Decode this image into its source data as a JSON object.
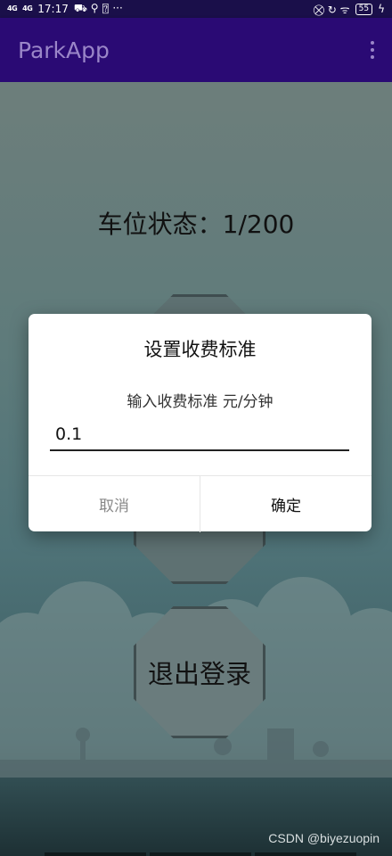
{
  "status_bar": {
    "signal1": "4G",
    "signal2": "4G",
    "time": "17:17",
    "app_icons": "⛟ ⚲ ⍰ ···",
    "right_icons": "⛒ ↻ ᯤ",
    "battery": "55"
  },
  "app_bar": {
    "title": "ParkApp"
  },
  "main": {
    "parking_status": "车位状态：1/200",
    "logout_label": "退出登录"
  },
  "dialog": {
    "title": "设置收费标准",
    "message": "输入收费标准 元/分钟",
    "input_value": "0.1",
    "cancel_label": "取消",
    "confirm_label": "确定"
  },
  "watermark": "CSDN @biyezuopin"
}
